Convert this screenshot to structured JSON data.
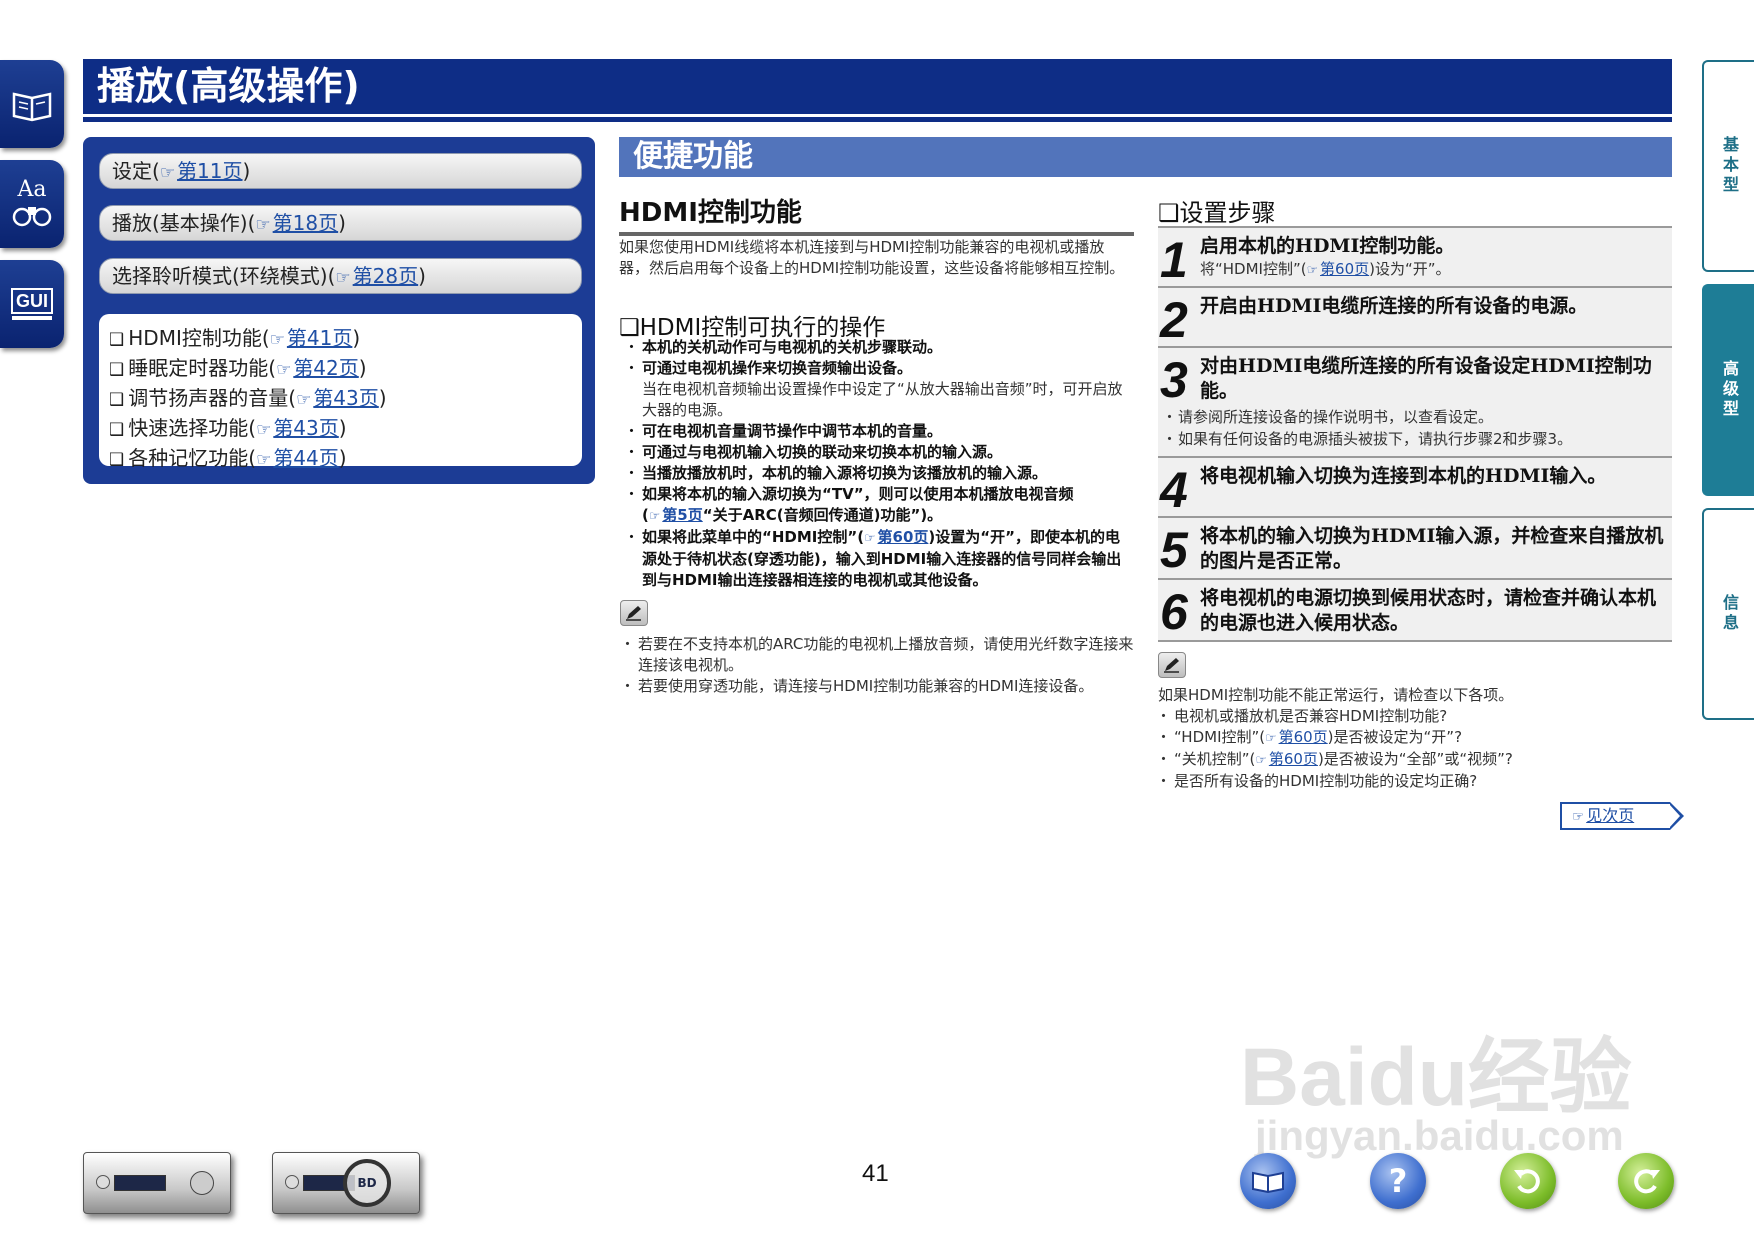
{
  "header": {
    "title": "播放(高级操作)"
  },
  "nav": {
    "pills": [
      {
        "label": "设定(",
        "link": "第11页",
        "close": ")"
      },
      {
        "label": "播放(基本操作)(",
        "link": "第18页",
        "close": ")"
      },
      {
        "label": "选择聆听模式(环绕模式)(",
        "link": "第28页",
        "close": ")"
      }
    ],
    "list": [
      {
        "label": "HDMI控制功能(",
        "link": "第41页",
        "close": ")"
      },
      {
        "label": "睡眠定时器功能(",
        "link": "第42页",
        "close": ")"
      },
      {
        "label": "调节扬声器的音量(",
        "link": "第43页",
        "close": ")"
      },
      {
        "label": "快速选择功能(",
        "link": "第43页",
        "close": ")"
      },
      {
        "label": "各种记忆功能(",
        "link": "第44页",
        "close": ")"
      }
    ]
  },
  "section": {
    "title": "便捷功能"
  },
  "hdmi": {
    "title": "HDMI控制功能",
    "intro": "如果您使用HDMI线缆将本机连接到与HDMI控制功能兼容的电视机或播放器，然后启用每个设备上的HDMI控制功能设置，这些设备将能够相互控制。",
    "ops_title": "❑HDMI控制可执行的操作",
    "ops": {
      "op1": "本机的关机动作可与电视机的关机步骤联动。",
      "op2": "可通过电视机操作来切换音频输出设备。",
      "op2_sub": "当在电视机音频输出设置操作中设定了“从放大器输出音频”时，可开启放大器的电源。",
      "op3": "可在电视机音量调节操作中调节本机的音量。",
      "op4": "可通过与电视机输入切换的联动来切换本机的输入源。",
      "op5": "当播放播放机时，本机的输入源将切换为该播放机的输入源。",
      "op6": "如果将本机的输入源切换为“TV”，则可以使用本机播放电视音频",
      "op6_open": "(",
      "op6_link": "第5页",
      "op6_tail": "“关于ARC(音频回传通道)功能”)。",
      "op7_a": "如果将此菜单中的“HDMI控制”(",
      "op7_link": "第60页",
      "op7_b": ")设置为“开”，即使本机的电源处于待机状态(穿透功能)，输入到HDMI输入连接器的信号同样会输出到与HDMI输出连接器相连接的电视机或其他设备。"
    },
    "notes": [
      "若要在不支持本机的ARC功能的电视机上播放音频，请使用光纤数字连接来连接该电视机。",
      "若要使用穿透功能，请连接与HDMI控制功能兼容的HDMI连接设备。"
    ]
  },
  "steps": {
    "title": "❑设置步骤",
    "s1": {
      "num": "1",
      "text": "启用本机的HDMI控制功能。",
      "sub_a": "将“HDMI控制”(",
      "sub_link": "第60页",
      "sub_b": ")设为“开”。"
    },
    "s2": {
      "num": "2",
      "text": "开启由HDMI电缆所连接的所有设备的电源。"
    },
    "s3": {
      "num": "3",
      "text": "对由HDMI电缆所连接的所有设备设定HDMI控制功能。",
      "b1": "请参阅所连接设备的操作说明书，以查看设定。",
      "b2": "如果有任何设备的电源插头被拔下，请执行步骤2和步骤3。"
    },
    "s4": {
      "num": "4",
      "text": "将电视机输入切换为连接到本机的HDMI输入。"
    },
    "s5": {
      "num": "5",
      "text": "将本机的输入切换为HDMI输入源，并检查来自播放机的图片是否正常。"
    },
    "s6": {
      "num": "6",
      "text": "将电视机的电源切换到候用状态时，请检查并确认本机的电源也进入候用状态。"
    }
  },
  "troubleshoot": {
    "intro": "如果HDMI控制功能不能正常运行，请检查以下各项。",
    "i1": "电视机或播放机是否兼容HDMI控制功能?",
    "i2_a": "“HDMI控制”(",
    "i2_link": "第60页",
    "i2_b": ")是否被设定为“开”?",
    "i3_a": "“关机控制”(",
    "i3_link": "第60页",
    "i3_b": ")是否被设为“全部”或“视频”?",
    "i4": "是否所有设备的HDMI控制功能的设定均正确?"
  },
  "next_page": "见次页",
  "side_tabs": [
    "基本型",
    "高级型",
    "信息"
  ],
  "left_icons": {
    "aa": "Aa",
    "gui": "GUI"
  },
  "footer": {
    "page_number": "41",
    "device_label": "BD"
  },
  "watermark": {
    "main": "Baidu经验",
    "sub": "jingyan.baidu.com"
  }
}
